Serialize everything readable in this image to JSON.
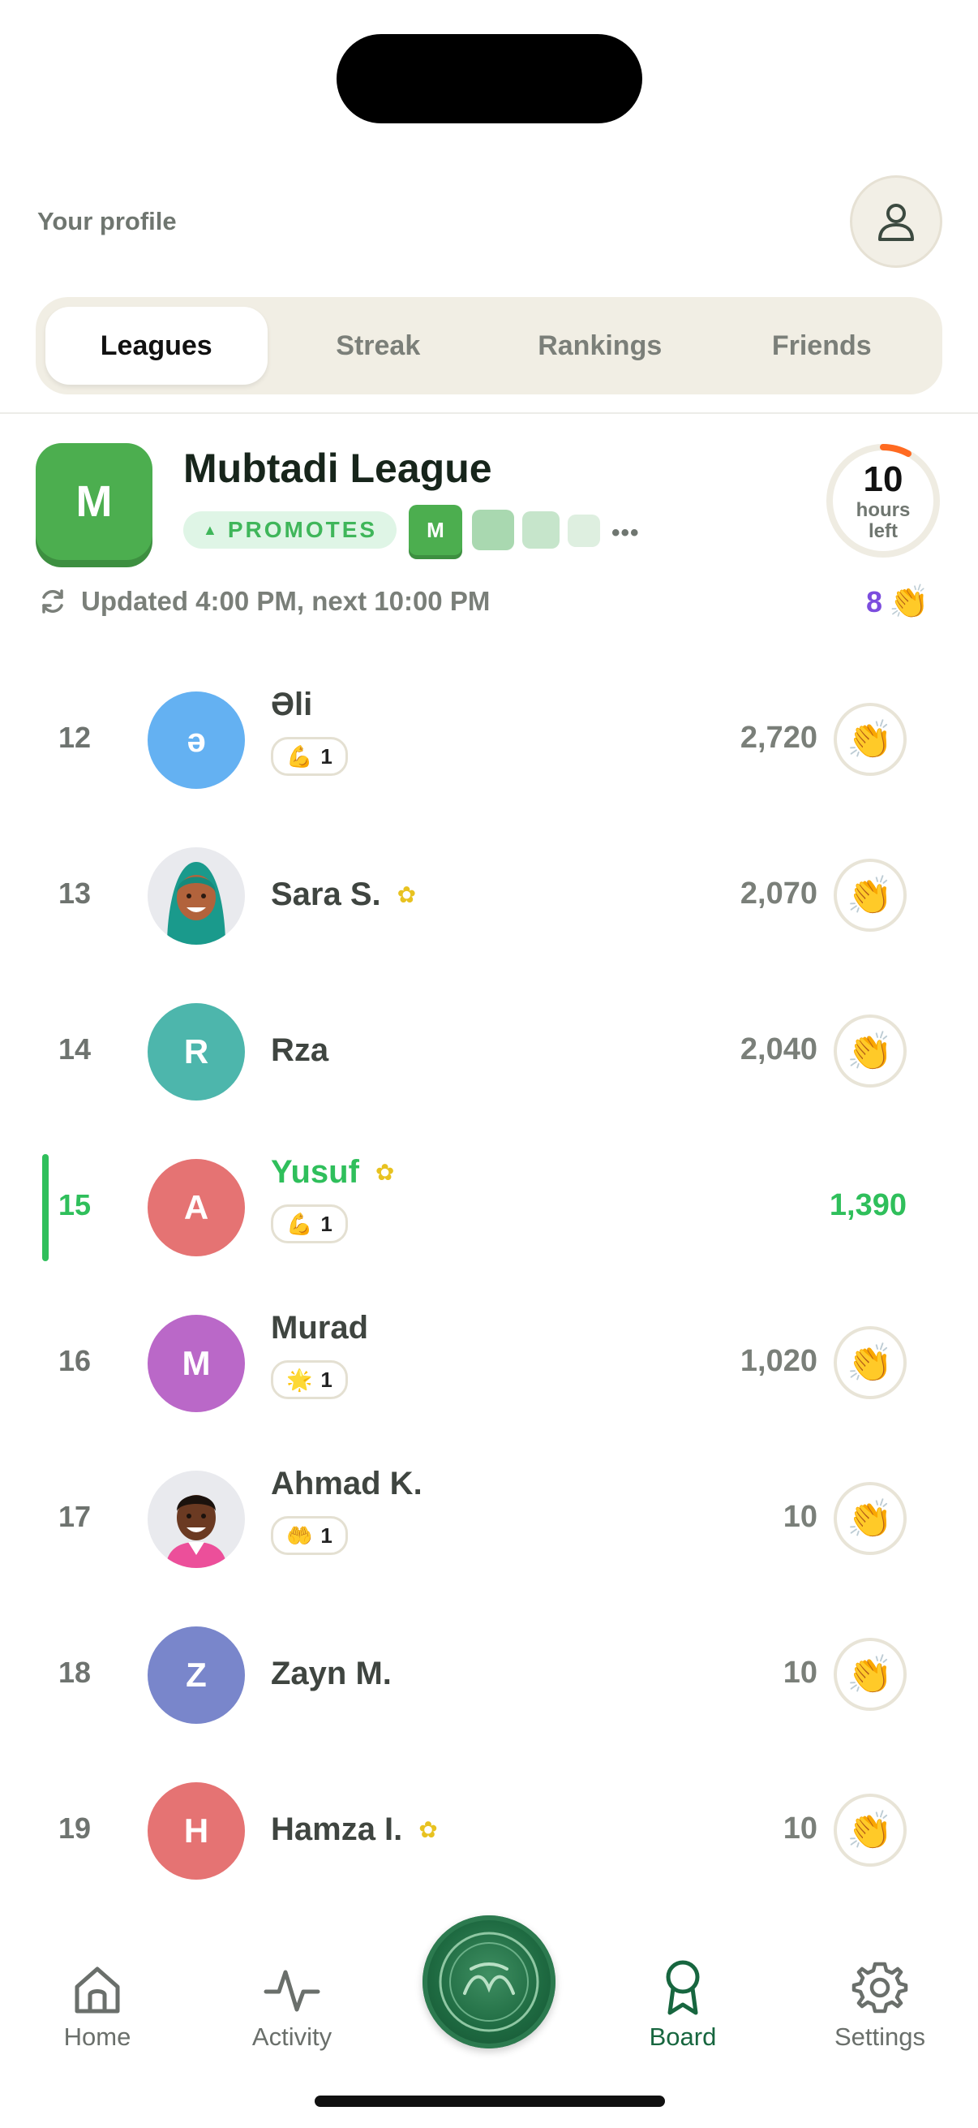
{
  "header": {
    "profile_label": "Your profile",
    "profile_icon": "person-icon"
  },
  "tabs": [
    {
      "label": "Leagues",
      "active": true
    },
    {
      "label": "Streak",
      "active": false
    },
    {
      "label": "Rankings",
      "active": false
    },
    {
      "label": "Friends",
      "active": false
    }
  ],
  "league": {
    "badge_letter": "M",
    "title": "Mubtadi League",
    "promotes_label": "PROMOTES",
    "tier_letter": "M",
    "timer_value": "10",
    "timer_unit_1": "hours",
    "timer_unit_2": "left",
    "updated_text": "Updated 4:00 PM, next 10:00 PM",
    "claps_count": "8",
    "accent_color": "#4cae4f"
  },
  "rows": [
    {
      "rank": "12",
      "name": "Əli",
      "initial": "ə",
      "avatar_color": "#64b1f2",
      "badge": {
        "emoji": "💪",
        "count": "1"
      },
      "score": "2,720",
      "flower": false
    },
    {
      "rank": "13",
      "name": "Sara S.",
      "initial": "",
      "avatar_color": "#e9eaee",
      "score": "2,070",
      "flower": true
    },
    {
      "rank": "14",
      "name": "Rza",
      "initial": "R",
      "avatar_color": "#4db6ac",
      "score": "2,040",
      "flower": false
    },
    {
      "rank": "15",
      "name": "Yusuf",
      "initial": "A",
      "avatar_color": "#e57373",
      "badge": {
        "emoji": "💪",
        "count": "1"
      },
      "score": "1,390",
      "flower": true,
      "me": true
    },
    {
      "rank": "16",
      "name": "Murad",
      "initial": "M",
      "avatar_color": "#ba68c8",
      "badge": {
        "emoji": "🌟",
        "count": "1"
      },
      "score": "1,020",
      "flower": false
    },
    {
      "rank": "17",
      "name": "Ahmad K.",
      "initial": "",
      "avatar_color": "#e9eaee",
      "badge": {
        "emoji": "🤲",
        "count": "1"
      },
      "score": "10",
      "flower": false
    },
    {
      "rank": "18",
      "name": "Zayn M.",
      "initial": "Z",
      "avatar_color": "#7986cb",
      "score": "10",
      "flower": false
    },
    {
      "rank": "19",
      "name": "Hamza I.",
      "initial": "H",
      "avatar_color": "#e57373",
      "score": "10",
      "flower": true
    }
  ],
  "nav": {
    "home": "Home",
    "activity": "Activity",
    "board": "Board",
    "settings": "Settings"
  }
}
